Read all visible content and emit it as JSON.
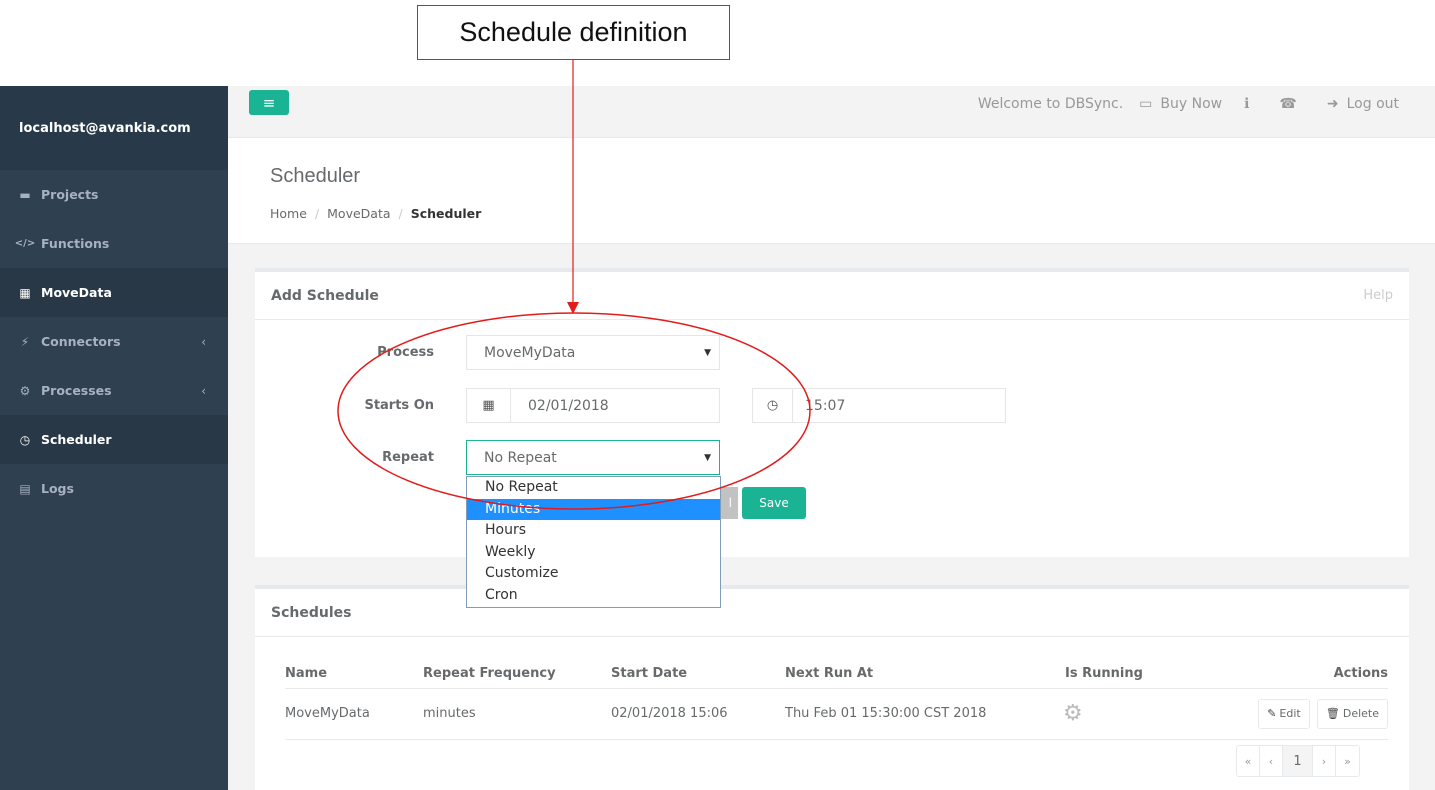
{
  "annotation": {
    "label": "Schedule definition",
    "color": "#e21b1b"
  },
  "sidebar": {
    "user": "localhost@avankia.com",
    "items": [
      {
        "label": "Projects",
        "icon": "projects-icon",
        "glyph": "▬",
        "active": false,
        "chevron": ""
      },
      {
        "label": "Functions",
        "icon": "code-icon",
        "glyph": "</>",
        "active": false,
        "chevron": ""
      },
      {
        "label": "MoveData",
        "icon": "grid-icon",
        "glyph": "▦",
        "active": true,
        "chevron": ""
      },
      {
        "label": "Connectors",
        "icon": "plug-icon",
        "glyph": "⚡",
        "active": false,
        "chevron": "‹"
      },
      {
        "label": "Processes",
        "icon": "cogs-icon",
        "glyph": "⚙",
        "active": false,
        "chevron": "‹"
      },
      {
        "label": "Scheduler",
        "icon": "clock-icon",
        "glyph": "◷",
        "active": true,
        "chevron": ""
      },
      {
        "label": "Logs",
        "icon": "file-icon",
        "glyph": "▤",
        "active": false,
        "chevron": ""
      }
    ]
  },
  "topbar": {
    "menu_glyph": "≡",
    "welcome": "Welcome to DBSync.",
    "buy_now": "Buy Now",
    "buy_glyph": "▭",
    "info_glyph": "ℹ",
    "phone_glyph": "☎",
    "logout": "Log out",
    "logout_glyph": "➜"
  },
  "page": {
    "title": "Scheduler",
    "breadcrumb": [
      "Home",
      "MoveData",
      "Scheduler"
    ],
    "breadcrumb_sep": "/"
  },
  "add_schedule": {
    "title": "Add Schedule",
    "help": "Help",
    "process_label": "Process",
    "process_value": "MoveMyData",
    "starts_on_label": "Starts On",
    "date_value": "02/01/2018",
    "time_value": "15:07",
    "repeat_label": "Repeat",
    "repeat_value": "No Repeat",
    "repeat_options": [
      "No Repeat",
      "Minutes",
      "Hours",
      "Weekly",
      "Customize",
      "Cron"
    ],
    "repeat_highlighted": "Minutes",
    "cancel_label": "Cancel",
    "save_label": "Save",
    "caret": "▼",
    "calendar_glyph": "▦",
    "clock_glyph": "◷"
  },
  "schedules": {
    "title": "Schedules",
    "columns": [
      "Name",
      "Repeat Frequency",
      "Start Date",
      "Next Run At",
      "Is Running",
      "Actions"
    ],
    "rows": [
      {
        "name": "MoveMyData",
        "repeat_frequency": "minutes",
        "start_date": "02/01/2018 15:06",
        "next_run_at": "Thu Feb 01 15:30:00 CST 2018",
        "is_running_icon": "gear-icon",
        "edit_label": "Edit",
        "delete_label": "Delete"
      }
    ],
    "pagination": [
      "«",
      "‹",
      "1",
      "›",
      "»"
    ],
    "current_page": "1"
  }
}
